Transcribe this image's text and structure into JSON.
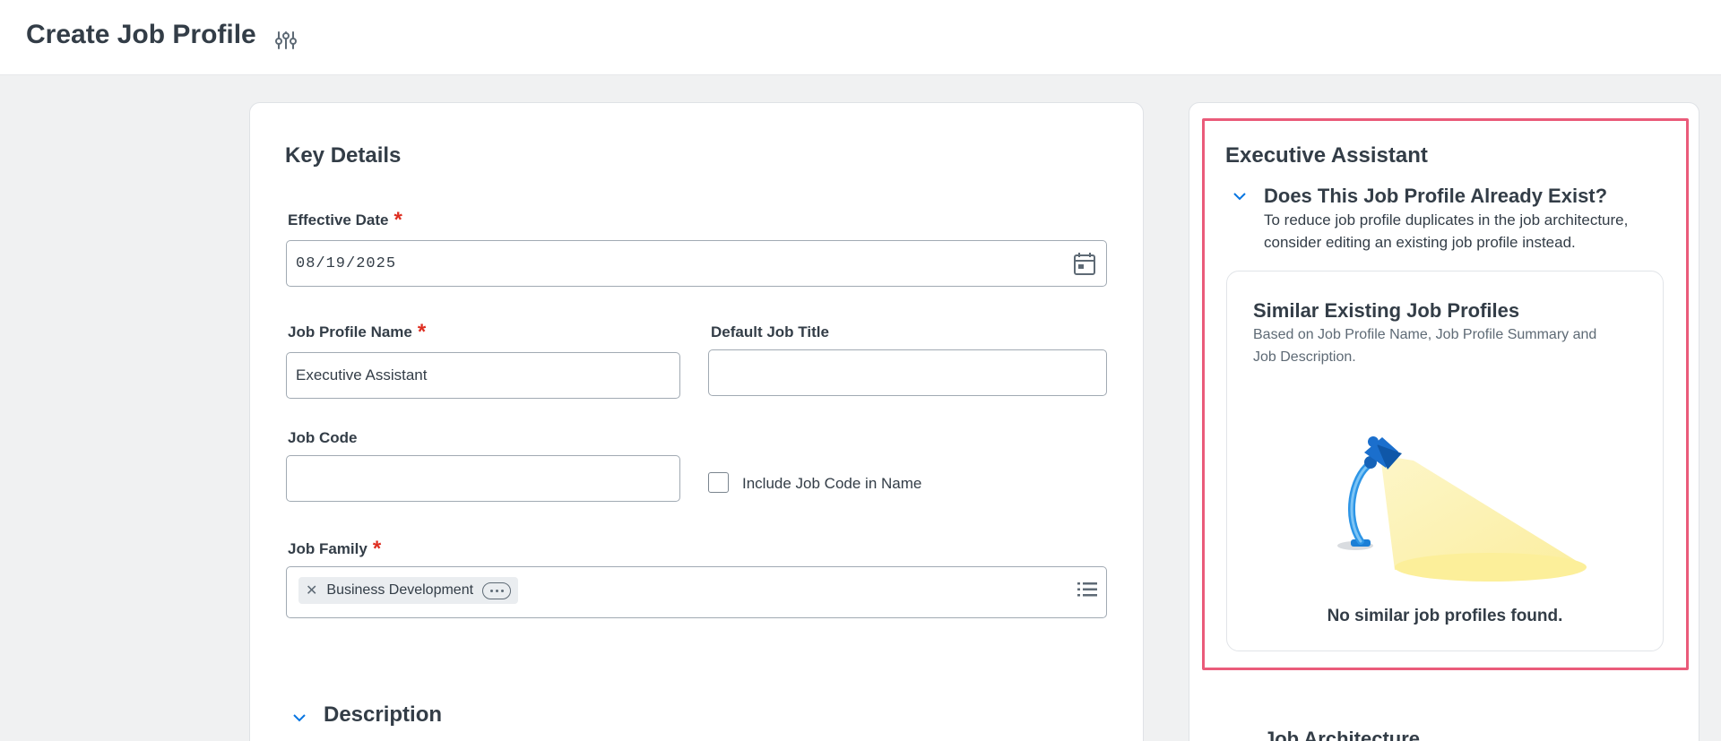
{
  "header": {
    "title": "Create Job Profile",
    "settings_icon": "sliders-icon"
  },
  "key_details": {
    "title": "Key Details",
    "effective_date": {
      "label": "Effective Date",
      "required": "*",
      "value": "08/19/2025",
      "icon": "calendar-icon"
    },
    "job_profile_name": {
      "label": "Job Profile Name",
      "required": "*",
      "value": "Executive Assistant"
    },
    "default_job_title": {
      "label": "Default Job Title",
      "value": ""
    },
    "job_code": {
      "label": "Job Code",
      "value": ""
    },
    "include_job_code": {
      "label": "Include Job Code in Name",
      "checked": false
    },
    "job_family": {
      "label": "Job Family",
      "required": "*",
      "selected": [
        "Business Development"
      ],
      "icon": "list-icon"
    },
    "description": {
      "title": "Description"
    }
  },
  "side_panel": {
    "title": "Executive Assistant",
    "exist_question": "Does This Job Profile Already Exist?",
    "exist_text_1": "To reduce job profile duplicates in the job architecture,",
    "exist_text_2": "consider editing an existing job profile instead.",
    "similar": {
      "title": "Similar Existing Job Profiles",
      "subtitle_1": "Based on Job Profile Name, Job Profile Summary and",
      "subtitle_2": "Job Description.",
      "empty_message": "No similar job profiles found."
    },
    "next_section": "Job Architecture"
  },
  "colors": {
    "accent": "#0875e1",
    "required": "#de2e21",
    "highlight": "#ea5b7a"
  }
}
